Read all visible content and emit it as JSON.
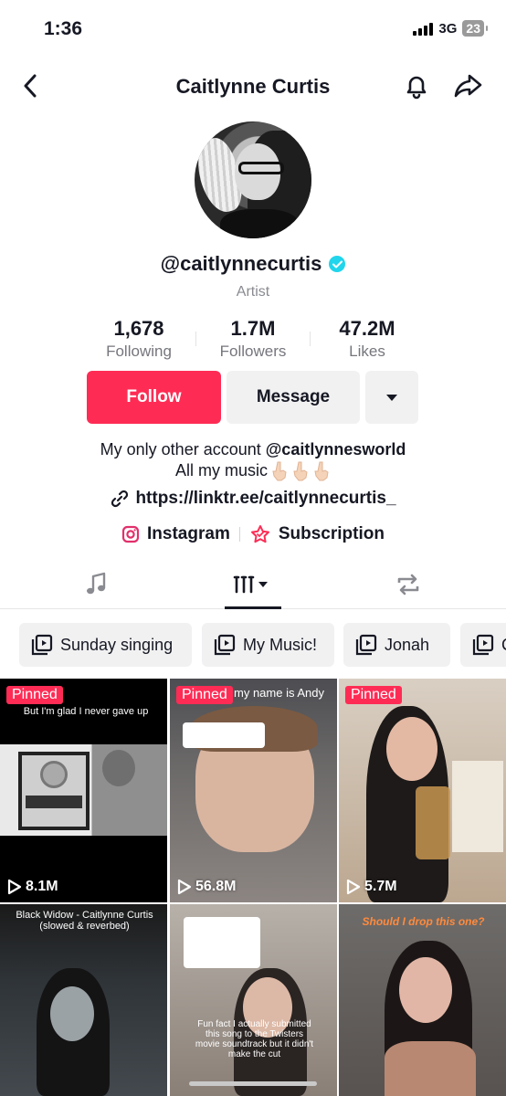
{
  "status_bar": {
    "time": "1:36",
    "network": "3G",
    "battery": "23"
  },
  "header": {
    "title": "Caitlynne Curtis"
  },
  "profile": {
    "username": "@caitlynnecurtis",
    "category": "Artist",
    "stats": [
      {
        "value": "1,678",
        "label": "Following"
      },
      {
        "value": "1.7M",
        "label": "Followers"
      },
      {
        "value": "47.2M",
        "label": "Likes"
      }
    ],
    "follow_label": "Follow",
    "message_label": "Message",
    "bio": {
      "line1_prefix": "My only other account ",
      "line1_handle": "@caitlynnesworld",
      "line2": "All my music"
    },
    "link": "https://linktr.ee/caitlynnecurtis_",
    "social": [
      {
        "label": "Instagram",
        "icon": "instagram-icon"
      },
      {
        "label": "Subscription",
        "icon": "subscription-icon"
      }
    ]
  },
  "playlists": [
    {
      "label": "Sunday singing"
    },
    {
      "label": "My Music!"
    },
    {
      "label": "Jonah"
    },
    {
      "label": "C"
    }
  ],
  "videos": [
    {
      "pinned": "Pinned",
      "views": "8.1M",
      "caption": "But I'm glad I never gave up"
    },
    {
      "pinned": "Pinned",
      "views": "56.8M",
      "caption": "my name is Andy"
    },
    {
      "pinned": "Pinned",
      "views": "5.7M",
      "caption": ""
    },
    {
      "caption": "Black Widow - Caitlynne Curtis (slowed & reverbed)"
    },
    {
      "caption": "Fun fact I actually submitted this song to the Twisters movie soundtrack but it didn't make the cut"
    },
    {
      "caption": "Should I drop this one?"
    }
  ],
  "colors": {
    "accent": "#fe2c55",
    "verified": "#20d5ec",
    "chip_bg": "#f1f1f2"
  }
}
